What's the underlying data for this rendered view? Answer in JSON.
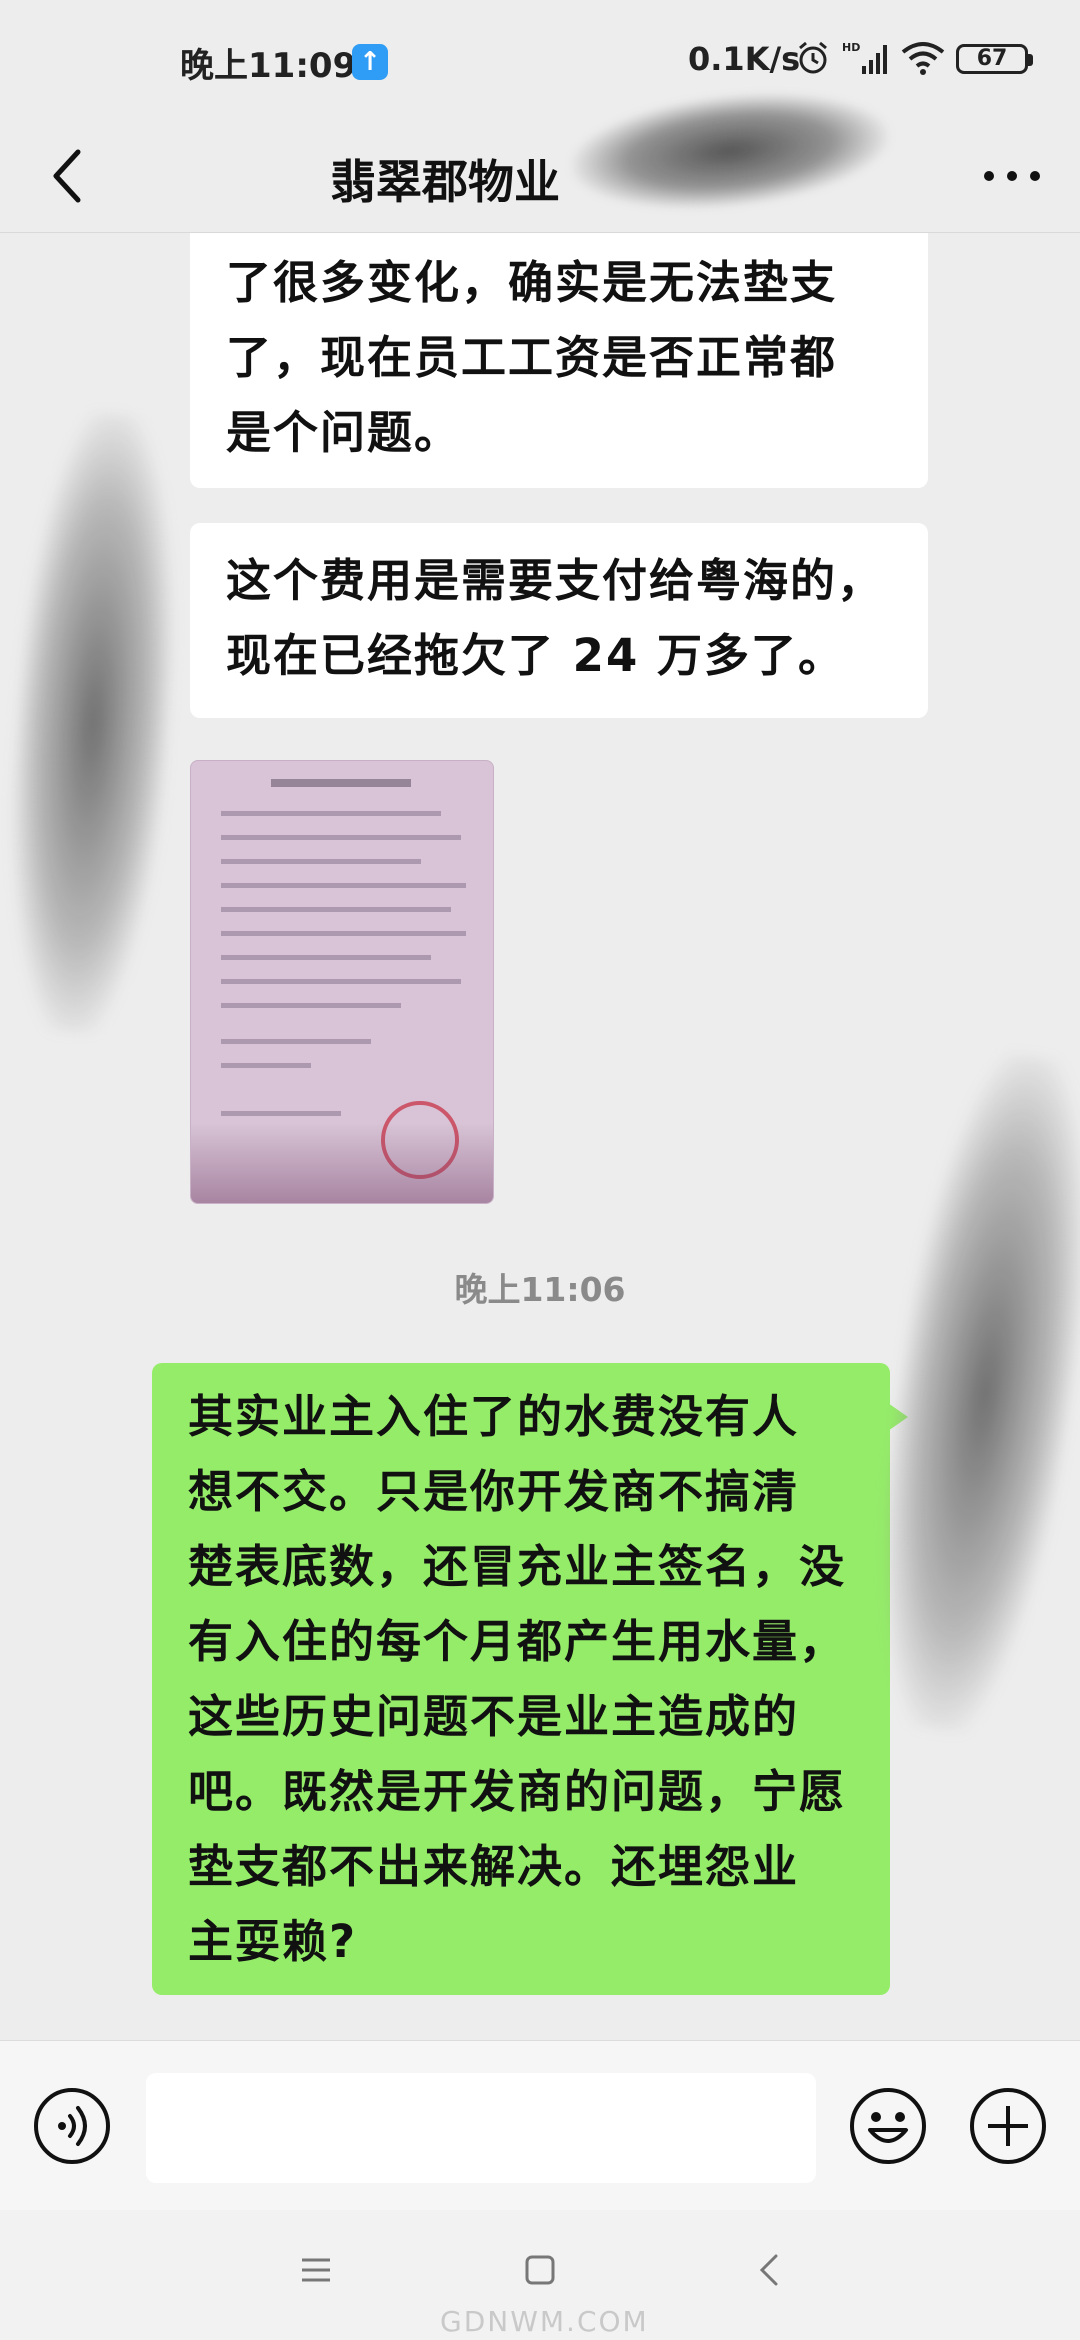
{
  "status_bar": {
    "time": "晚上11:09",
    "net_speed": "0.1K/s",
    "signal_label": "HD",
    "battery": "67"
  },
  "header": {
    "title": "翡翠郡物业"
  },
  "messages": [
    {
      "direction": "in",
      "lines": [
        "了很多变化，确实是无法垫支",
        "了，现在员工工资是否正常都",
        "是个问题。"
      ]
    },
    {
      "direction": "in",
      "lines": [
        "这个费用是需要支付给粤海的，",
        "现在已经拖欠了 24 万多了。"
      ]
    },
    {
      "direction": "in",
      "type": "image"
    },
    {
      "direction": "out",
      "lines": [
        "其实业主入住了的水费没有人",
        "想不交。只是你开发商不搞清",
        "楚表底数，还冒充业主签名，没",
        "有入住的每个月都产生用水量，",
        "这些历史问题不是业主造成的",
        "吧。既然是开发商的问题，宁愿",
        "垫支都不出来解决。还埋怨业",
        "主耍赖?"
      ]
    }
  ],
  "timestamp": "晚上11:06",
  "input": {
    "value": "",
    "placeholder": ""
  },
  "icons": {
    "back": "chevron-left-icon",
    "more": "more-dots-icon",
    "voice": "voice-icon",
    "emoji": "emoji-icon",
    "plus": "plus-icon"
  },
  "colors": {
    "background": "#ededed",
    "incoming_bubble": "#ffffff",
    "outgoing_bubble": "#95ec69",
    "upload_badge": "#2f9cf5"
  },
  "watermark": "GDNWM.COM"
}
